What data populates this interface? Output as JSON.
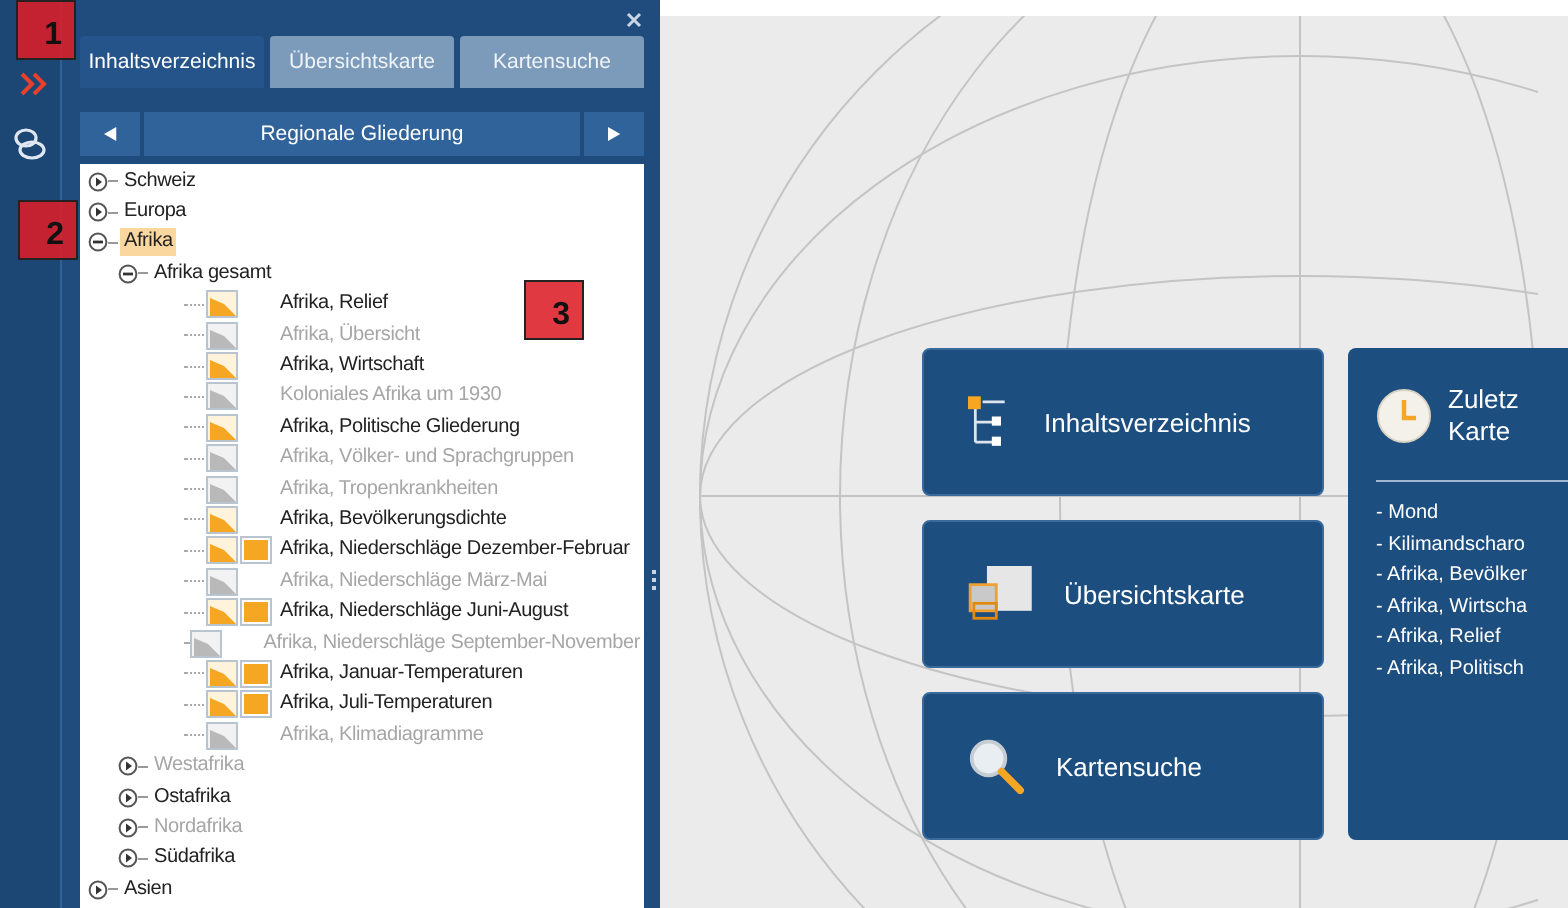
{
  "tabs": [
    {
      "label": "Inhaltsverzeichnis",
      "selected": true
    },
    {
      "label": "Übersichtskarte",
      "selected": false
    },
    {
      "label": "Kartensuche",
      "selected": false
    }
  ],
  "navigator": {
    "title": "Regionale Gliederung"
  },
  "tree": [
    {
      "label": "Schweiz",
      "expanded": false,
      "selected": false,
      "disabled": false
    },
    {
      "label": "Europa",
      "expanded": false,
      "selected": false,
      "disabled": false
    },
    {
      "label": "Afrika",
      "expanded": true,
      "selected": true,
      "disabled": false,
      "children": [
        {
          "label": "Afrika gesamt",
          "expanded": true,
          "disabled": false,
          "children": [
            {
              "label": "Afrika, Relief",
              "kind": "single",
              "disabled": false
            },
            {
              "label": "Afrika, Übersicht",
              "kind": "single",
              "disabled": true
            },
            {
              "label": "Afrika, Wirtschaft",
              "kind": "single",
              "disabled": false
            },
            {
              "label": "Koloniales Afrika um 1930",
              "kind": "single",
              "disabled": true
            },
            {
              "label": "Afrika, Politische Gliederung",
              "kind": "single",
              "disabled": false
            },
            {
              "label": "Afrika, Völker- und Sprachgruppen",
              "kind": "single",
              "disabled": true
            },
            {
              "label": "Afrika, Tropenkrankheiten",
              "kind": "single",
              "disabled": true
            },
            {
              "label": "Afrika, Bevölkerungsdichte",
              "kind": "single",
              "disabled": false
            },
            {
              "label": "Afrika, Niederschläge Dezember-Februar",
              "kind": "double",
              "disabled": false
            },
            {
              "label": "Afrika, Niederschläge März-Mai",
              "kind": "single",
              "disabled": true
            },
            {
              "label": "Afrika, Niederschläge Juni-August",
              "kind": "double",
              "disabled": false
            },
            {
              "label": "Afrika, Niederschläge September-November",
              "kind": "single",
              "disabled": true
            },
            {
              "label": "Afrika, Januar-Temperaturen",
              "kind": "double",
              "disabled": false
            },
            {
              "label": "Afrika, Juli-Temperaturen",
              "kind": "double",
              "disabled": false
            },
            {
              "label": "Afrika, Klimadiagramme",
              "kind": "single",
              "disabled": true
            }
          ]
        },
        {
          "label": "Westafrika",
          "expanded": false,
          "disabled": true
        },
        {
          "label": "Ostafrika",
          "expanded": false,
          "disabled": false
        },
        {
          "label": "Nordafrika",
          "expanded": false,
          "disabled": true
        },
        {
          "label": "Südafrika",
          "expanded": false,
          "disabled": false
        }
      ]
    },
    {
      "label": "Asien",
      "expanded": false,
      "selected": false,
      "disabled": false
    }
  ],
  "home_cards": [
    {
      "kind": "contents",
      "label": "Inhaltsverzeichnis"
    },
    {
      "kind": "overview",
      "label": "Übersichtskarte"
    },
    {
      "kind": "search",
      "label": "Kartensuche"
    }
  ],
  "recent": {
    "title_lines": [
      "Zuletz",
      "Karte"
    ],
    "items": [
      "- Mond",
      "- Kilimandscharo",
      "- Afrika, Bevölker",
      "- Afrika, Wirtscha",
      "- Afrika, Relief",
      "- Afrika, Politisch"
    ]
  },
  "annotations": [
    "1",
    "2",
    "3"
  ]
}
